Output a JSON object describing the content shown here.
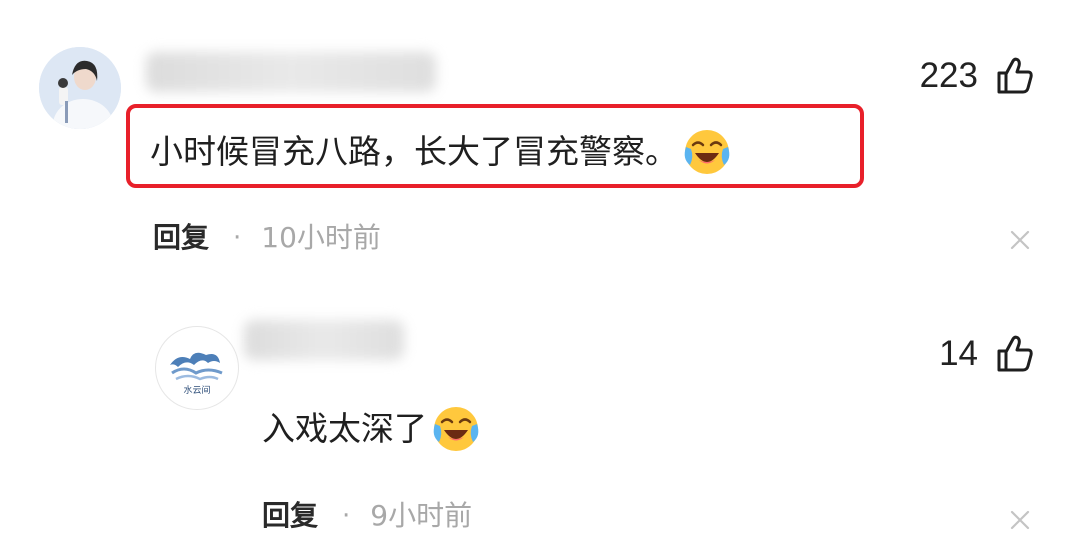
{
  "comments": [
    {
      "like_count": "223",
      "text": "小时候冒充八路，长大了冒充警察。",
      "emoji": "laughing-crying-emoji",
      "reply_label": "回复",
      "separator": "·",
      "time": "10小时前",
      "highlighted": true,
      "highlight_color": "#e8202a"
    },
    {
      "like_count": "14",
      "text": "入戏太深了",
      "emoji": "laughing-crying-emoji",
      "reply_label": "回复",
      "separator": "·",
      "time": "9小时前",
      "avatar_text": "水云间"
    }
  ],
  "colors": {
    "meta_gray": "#a8a8a8",
    "text": "#1f1f1f"
  },
  "icons": [
    "thumbs-up-icon",
    "close-icon",
    "laughing-crying-emoji"
  ]
}
